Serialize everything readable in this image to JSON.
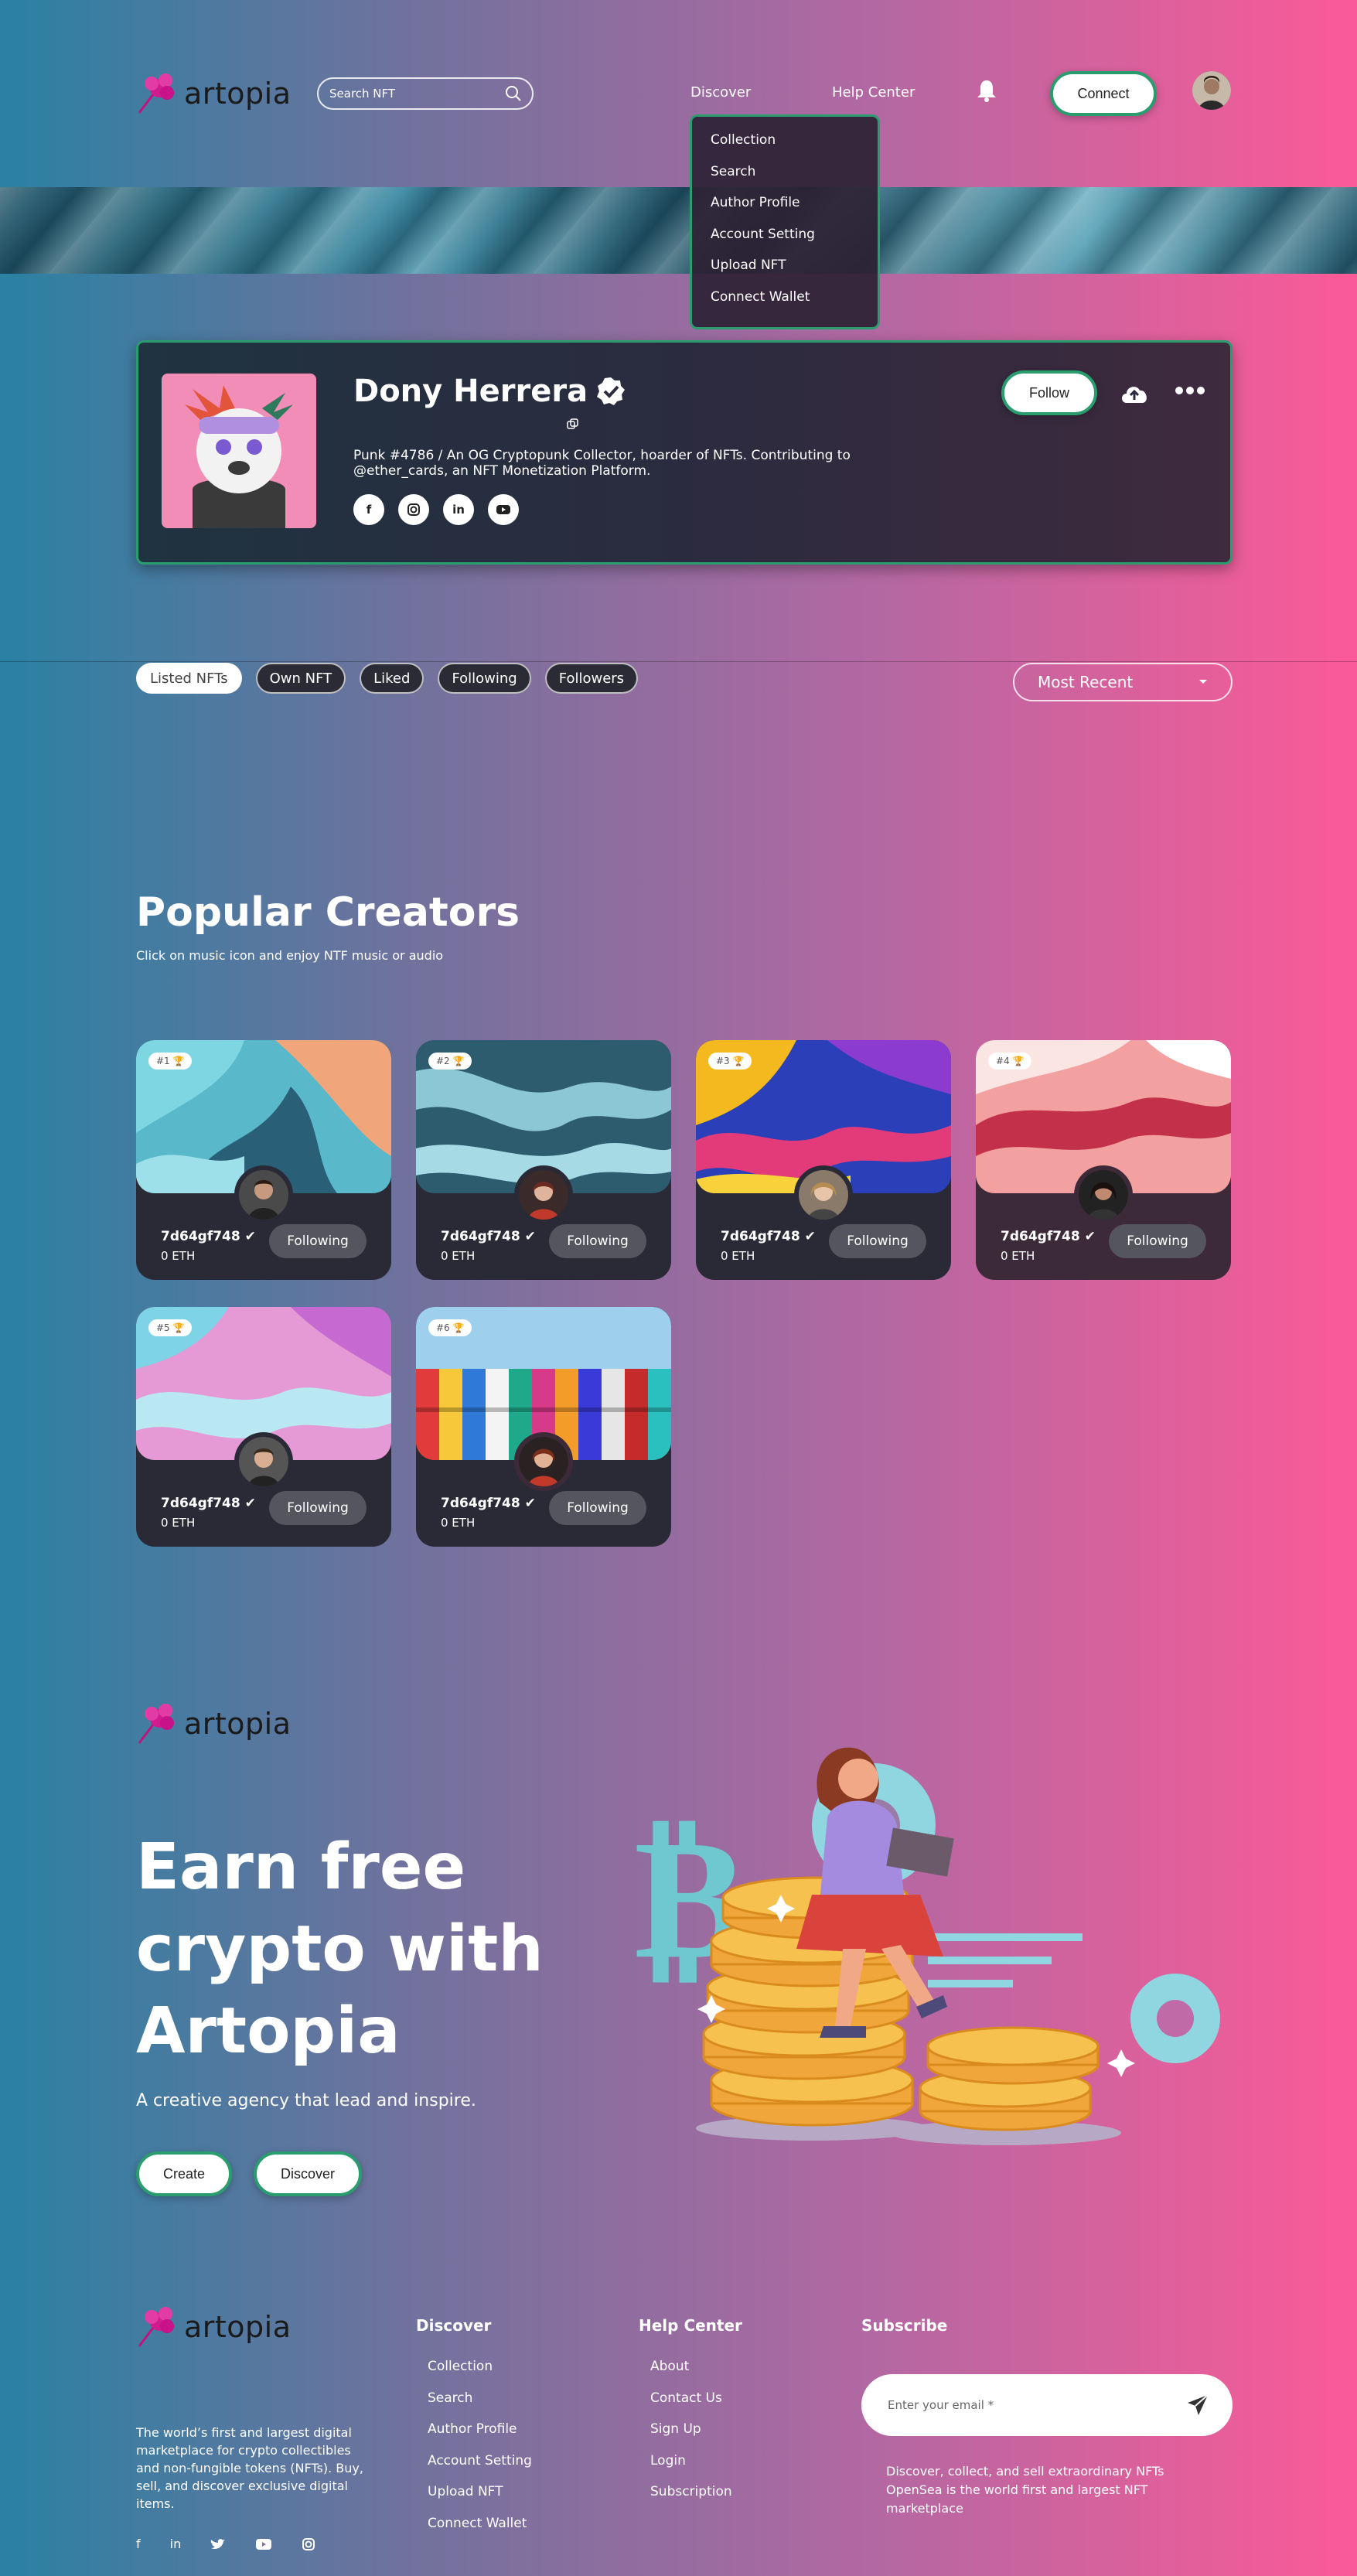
{
  "header": {
    "logo_text": "artopia",
    "search_placeholder": "Search NFT",
    "nav": {
      "discover": "Discover",
      "help_center": "Help Center"
    },
    "connect_label": "Connect"
  },
  "dropdown": {
    "items": [
      "Collection",
      "Search",
      "Author Profile",
      "Account Setting",
      "Upload NFT",
      "Connect Wallet"
    ]
  },
  "profile": {
    "name": "Dony Herrera",
    "bio_line1": "Punk #4786 / An OG Cryptopunk Collector, hoarder of NFTs. Contributing to",
    "bio_line2": "@ether_cards, an NFT Monetization Platform.",
    "follow_label": "Follow",
    "socials": [
      "f",
      "ig",
      "in",
      "yt"
    ]
  },
  "tabs": {
    "items": [
      "Listed NFTs",
      "Own NFT",
      "Liked",
      "Following",
      "Followers"
    ],
    "active": "Listed NFTs",
    "sort_label": "Most Recent"
  },
  "popular": {
    "title": "Popular Creators",
    "subtitle": "Click on music icon and enjoy NTF music or audio",
    "creators": [
      {
        "rank": "#1",
        "name": "7d64gf748",
        "eth": "0 ETH",
        "button": "Following"
      },
      {
        "rank": "#2",
        "name": "7d64gf748",
        "eth": "0 ETH",
        "button": "Following"
      },
      {
        "rank": "#3",
        "name": "7d64gf748",
        "eth": "0 ETH",
        "button": "Following"
      },
      {
        "rank": "#4",
        "name": "7d64gf748",
        "eth": "0 ETH",
        "button": "Following"
      },
      {
        "rank": "#5",
        "name": "7d64gf748",
        "eth": "0 ETH",
        "button": "Following"
      },
      {
        "rank": "#6",
        "name": "7d64gf748",
        "eth": "0 ETH",
        "button": "Following"
      }
    ]
  },
  "hero": {
    "logo_text": "artopia",
    "title_line1": "Earn free",
    "title_line2": "crypto with",
    "title_line3": "Artopia",
    "subtitle": "A creative agency that lead and inspire.",
    "create_label": "Create",
    "discover_label": "Discover"
  },
  "footer": {
    "logo_text": "artopia",
    "about_text": "The world’s first and largest digital marketplace for crypto collectibles and non-fungible tokens (NFTs). Buy, sell, and discover exclusive digital items.",
    "discover_title": "Discover",
    "discover_links": [
      "Collection",
      "Search",
      "Author Profile",
      "Account Setting",
      "Upload NFT",
      "Connect Wallet"
    ],
    "help_title": "Help Center",
    "help_links": [
      "About",
      "Contact Us",
      "Sign Up",
      "Login",
      "Subscription"
    ],
    "subscribe_title": "Subscribe",
    "email_placeholder": "Enter your email *",
    "subscribe_text": "Discover, collect, and sell extraordinary NFTs OpenSea is the world first and largest NFT marketplace"
  },
  "colors": {
    "accent_green": "#2a9d6e",
    "gradient_left": "#2a81a3",
    "gradient_right": "#fb5a97"
  }
}
